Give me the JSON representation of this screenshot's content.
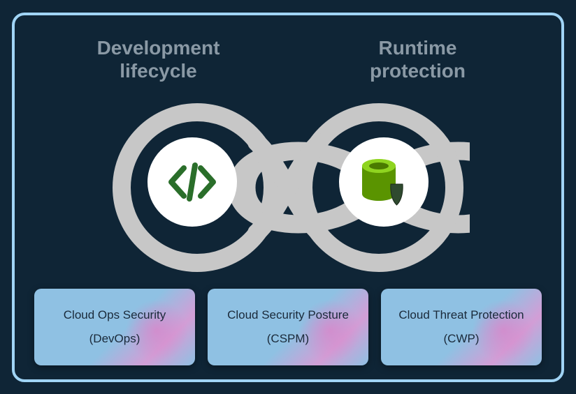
{
  "headings": {
    "left": "Development\nlifecycle",
    "right": "Runtime\nprotection"
  },
  "icons": {
    "left": "code-icon",
    "right": "datastore-shield-icon"
  },
  "cards": [
    {
      "title": "Cloud Ops Security",
      "subtitle": "(DevOps)"
    },
    {
      "title": "Cloud Security Posture",
      "subtitle": "(CSPM)"
    },
    {
      "title": "Cloud Threat Protection",
      "subtitle": "(CWP)"
    }
  ],
  "colors": {
    "border": "#a0d4f5",
    "background": "#0f2536",
    "headingText": "#8a99a5",
    "cardBg": "#8fc1e3",
    "infinityStroke": "#c7c7c7",
    "codeIcon": "#2a6e2a",
    "datastore": "#6bb300",
    "shield": "#3a5a3a"
  }
}
